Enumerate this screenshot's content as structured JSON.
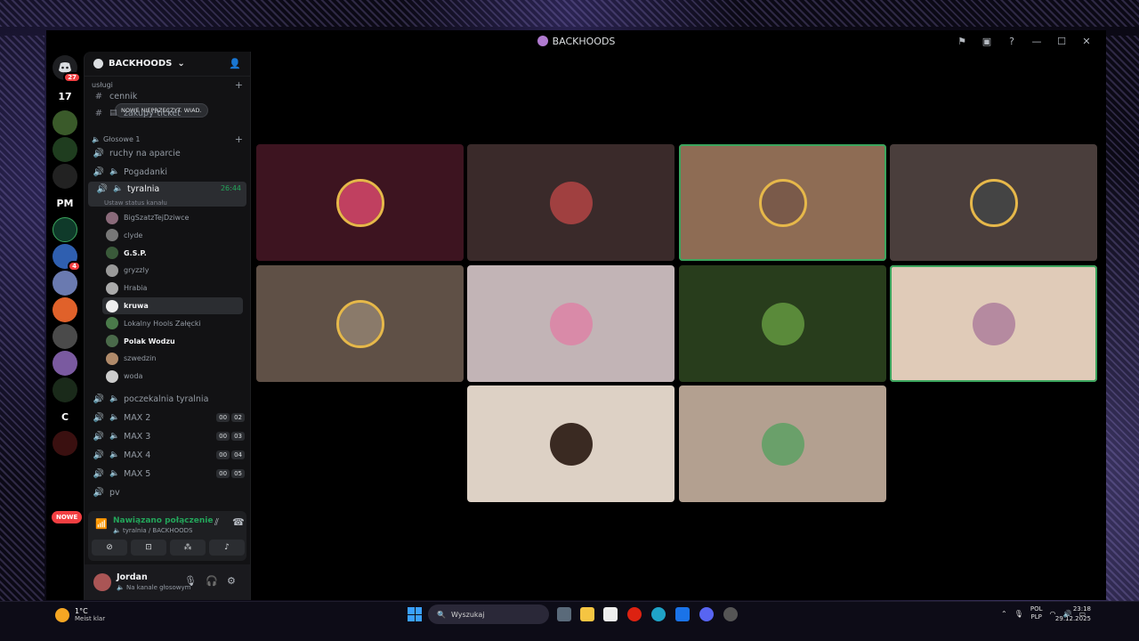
{
  "window": {
    "title": "BACKHOODS"
  },
  "rail": {
    "badge_count": "27",
    "server_badge": "4",
    "nowe_label": "NOWE",
    "server_pm": "PM",
    "server_c": "C",
    "server_17": "17"
  },
  "guild": {
    "name": "BACKHOODS"
  },
  "tooltip": "NOWE NIEPRZECZYT. WIAD.",
  "categories": {
    "services": "usługi",
    "voice": "Głosowe 1"
  },
  "channels": {
    "cennik": "cennik",
    "zakupy": "zakupy¹ticket",
    "ruchy": "ruchy na aparcie",
    "pogadanki": "Pogadanki",
    "tyralnia": "tyralnia",
    "tyralnia_timer": "26:44",
    "status": "Ustaw status kanału",
    "poczekalnia": "poczekalnia tyralnia",
    "max2": "MAX 2",
    "max2_a": "00",
    "max2_b": "02",
    "max3": "MAX 3",
    "max3_a": "00",
    "max3_b": "03",
    "max4": "MAX 4",
    "max4_a": "00",
    "max4_b": "04",
    "max5": "MAX 5",
    "max5_a": "00",
    "max5_b": "05",
    "pv": "pv"
  },
  "voice_users": [
    "BigSzatzTejDziwce",
    "clyde",
    "G.S.P.",
    "gryzzly",
    "Hrabia",
    "kruwa",
    "Lokalny Hools Załęcki",
    "Polak Wodzu",
    "szwedzin",
    "woda"
  ],
  "voice_panel": {
    "status": "Nawiązano połączenie",
    "sub": "tyralnia / BACKHOODS"
  },
  "user_panel": {
    "name": "Jordan",
    "status": "Na kanale głosowym"
  },
  "colors": {
    "accent_green": "#23a55a",
    "danger": "#f23f42",
    "brand": "#5865f2"
  },
  "taskbar": {
    "temp": "1°C",
    "weather": "Meist klar",
    "search": "Wyszukaj",
    "lang1": "POL",
    "lang2": "PLP",
    "time": "23:18",
    "date": "29.12.2025"
  }
}
